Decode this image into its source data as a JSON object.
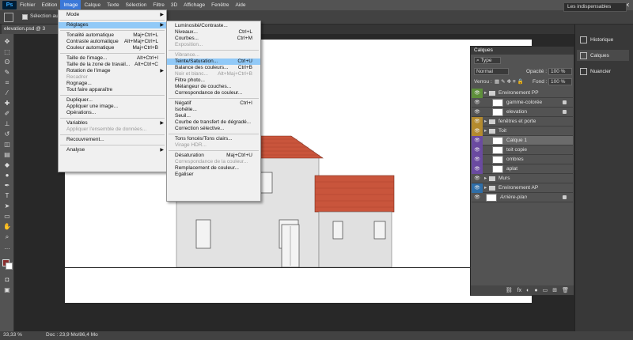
{
  "app": {
    "logo": "Ps"
  },
  "menubar": {
    "items": [
      "Fichier",
      "Edition",
      "Image",
      "Calque",
      "Texte",
      "Sélection",
      "Filtre",
      "3D",
      "Affichage",
      "Fenêtre",
      "Aide"
    ],
    "active_index": 2
  },
  "window_controls": {
    "minimize": "—",
    "maximize": "□",
    "close": "✕"
  },
  "options_bar": {
    "checkbox_label": "Sélection auto",
    "workspace": "Les indispensables"
  },
  "document": {
    "tab_label": "elevation.psd @ 3"
  },
  "status": {
    "zoom": "33,33 %",
    "doc_info": "Doc : 23,9 Mo/86,4 Mo"
  },
  "right_strip": {
    "items": [
      "Historique",
      "Calques",
      "Nuancier"
    ]
  },
  "image_menu": {
    "rows": [
      {
        "label": "Mode",
        "shortcut": "",
        "submenu": true
      },
      {
        "sep": true
      },
      {
        "label": "Réglages",
        "shortcut": "",
        "submenu": true,
        "highlighted": true
      },
      {
        "sep": true
      },
      {
        "label": "Tonalité automatique",
        "shortcut": "Maj+Ctrl+L"
      },
      {
        "label": "Contraste automatique",
        "shortcut": "Alt+Maj+Ctrl+L"
      },
      {
        "label": "Couleur automatique",
        "shortcut": "Maj+Ctrl+B"
      },
      {
        "sep": true
      },
      {
        "label": "Taille de l'image...",
        "shortcut": "Alt+Ctrl+I"
      },
      {
        "label": "Taille de la zone de travail...",
        "shortcut": "Alt+Ctrl+C"
      },
      {
        "label": "Rotation de l'image",
        "shortcut": "",
        "submenu": true
      },
      {
        "label": "Recadrer",
        "shortcut": "",
        "disabled": true
      },
      {
        "label": "Rognage...",
        "shortcut": ""
      },
      {
        "label": "Tout faire apparaître",
        "shortcut": ""
      },
      {
        "sep": true
      },
      {
        "label": "Dupliquer...",
        "shortcut": ""
      },
      {
        "label": "Appliquer une image...",
        "shortcut": ""
      },
      {
        "label": "Opérations...",
        "shortcut": ""
      },
      {
        "sep": true
      },
      {
        "label": "Variables",
        "shortcut": "",
        "submenu": true
      },
      {
        "label": "Appliquer l'ensemble de données...",
        "shortcut": "",
        "disabled": true
      },
      {
        "sep": true
      },
      {
        "label": "Recouvrement...",
        "shortcut": ""
      },
      {
        "sep": true
      },
      {
        "label": "Analyse",
        "shortcut": "",
        "submenu": true
      }
    ]
  },
  "reglages_menu": {
    "rows": [
      {
        "label": "Luminosité/Contraste...",
        "shortcut": ""
      },
      {
        "label": "Niveaux...",
        "shortcut": "Ctrl+L"
      },
      {
        "label": "Courbes...",
        "shortcut": "Ctrl+M"
      },
      {
        "label": "Exposition...",
        "shortcut": "",
        "disabled": true
      },
      {
        "sep": true
      },
      {
        "label": "Vibrance...",
        "shortcut": "",
        "disabled": true
      },
      {
        "label": "Teinte/Saturation...",
        "shortcut": "Ctrl+U",
        "highlighted": true
      },
      {
        "label": "Balance des couleurs...",
        "shortcut": "Ctrl+B"
      },
      {
        "label": "Noir et blanc...",
        "shortcut": "Alt+Maj+Ctrl+B",
        "disabled": true
      },
      {
        "label": "Filtre photo...",
        "shortcut": ""
      },
      {
        "label": "Mélangeur de couches...",
        "shortcut": ""
      },
      {
        "label": "Correspondance de couleur...",
        "shortcut": ""
      },
      {
        "sep": true
      },
      {
        "label": "Négatif",
        "shortcut": "Ctrl+I"
      },
      {
        "label": "Isohélie...",
        "shortcut": ""
      },
      {
        "label": "Seuil...",
        "shortcut": ""
      },
      {
        "label": "Courbe de transfert de dégradé...",
        "shortcut": ""
      },
      {
        "label": "Correction sélective...",
        "shortcut": ""
      },
      {
        "sep": true
      },
      {
        "label": "Tons foncés/Tons clairs...",
        "shortcut": ""
      },
      {
        "label": "Virage HDR...",
        "shortcut": "",
        "disabled": true
      },
      {
        "sep": true
      },
      {
        "label": "Désaturation",
        "shortcut": "Maj+Ctrl+U"
      },
      {
        "label": "Correspondance de la couleur...",
        "shortcut": "",
        "disabled": true
      },
      {
        "label": "Remplacement de couleur...",
        "shortcut": ""
      },
      {
        "label": "Egaliser",
        "shortcut": ""
      }
    ]
  },
  "layers_panel": {
    "title": "Calques",
    "filter": "Type",
    "blend_mode": "Normal",
    "opacity_label": "Opacité :",
    "opacity_value": "100 %",
    "lock_label": "Verrou :",
    "fill_label": "Fond :",
    "fill_value": "100 %",
    "layers": [
      {
        "name": "Environement PP",
        "type": "group",
        "color": "#5e8f3a",
        "indent": 0,
        "lock": false,
        "selected": false
      },
      {
        "name": "gamme-colorée",
        "type": "layer",
        "color": "",
        "indent": 1,
        "lock": true,
        "selected": false
      },
      {
        "name": "elevation",
        "type": "layer",
        "color": "",
        "indent": 1,
        "lock": true,
        "selected": false
      },
      {
        "name": "fenêtres et porte",
        "type": "group",
        "color": "#b38a2e",
        "indent": 0,
        "lock": false,
        "selected": false
      },
      {
        "name": "Toit",
        "type": "group",
        "color": "#b38a2e",
        "indent": 0,
        "lock": false,
        "selected": false
      },
      {
        "name": "Calque 1",
        "type": "layer",
        "color": "#6a4aa0",
        "indent": 1,
        "lock": false,
        "selected": true
      },
      {
        "name": "toit copie",
        "type": "layer",
        "color": "#6a4aa0",
        "indent": 1,
        "lock": false,
        "selected": false
      },
      {
        "name": "ombres",
        "type": "layer",
        "color": "#6a4aa0",
        "indent": 1,
        "lock": false,
        "selected": false
      },
      {
        "name": "aplat",
        "type": "layer",
        "color": "#6a4aa0",
        "indent": 1,
        "lock": false,
        "selected": false
      },
      {
        "name": "Murs",
        "type": "group",
        "color": "",
        "indent": 0,
        "lock": false,
        "selected": false
      },
      {
        "name": "Environement AP",
        "type": "group",
        "color": "#2f6ea8",
        "indent": 0,
        "lock": false,
        "selected": false
      },
      {
        "name": "Arrière-plan",
        "type": "layer",
        "color": "",
        "indent": 0,
        "lock": true,
        "selected": false
      }
    ],
    "bottom_icons": [
      "⛓",
      "fx",
      "◐",
      "●",
      "▭",
      "⊞",
      "🗑"
    ]
  }
}
